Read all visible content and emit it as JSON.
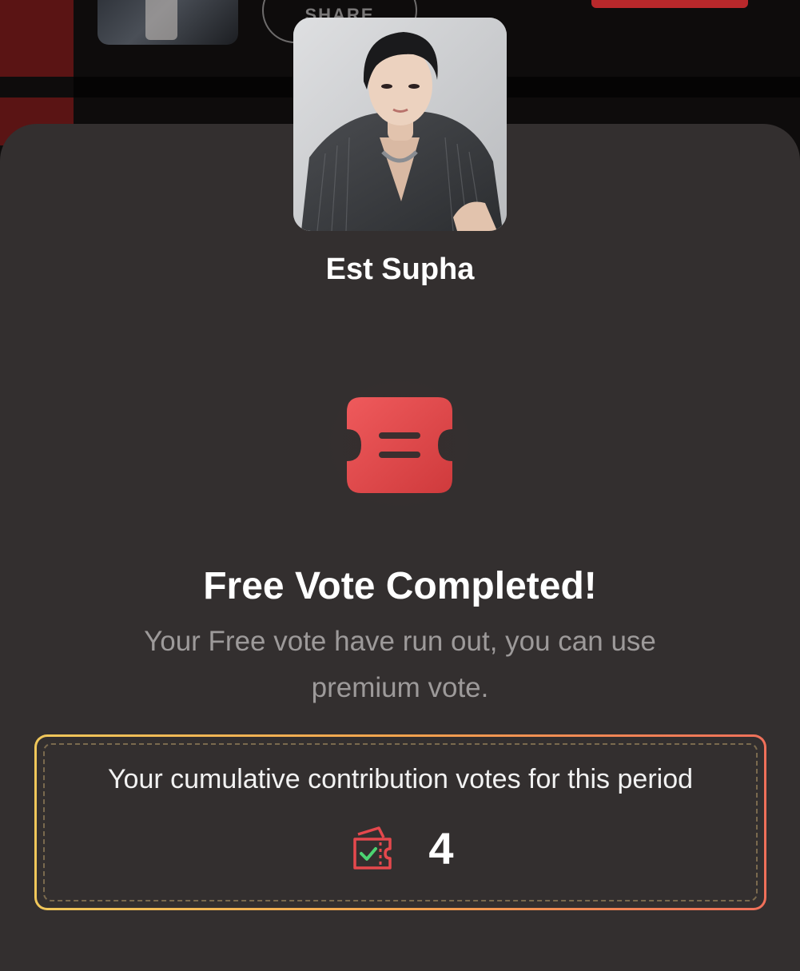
{
  "background": {
    "share_label": "SHARE"
  },
  "artist": {
    "name": "Est Supha"
  },
  "result": {
    "icon": "ticket-icon",
    "title": "Free Vote Completed!",
    "message": "Your Free vote have run out, you can use premium vote."
  },
  "contribution": {
    "label": "Your cumulative contribution votes for this period",
    "icon": "vote-ticket-check-icon",
    "count": "4"
  },
  "colors": {
    "sheet_bg": "#332f2f",
    "accent_red": "#e5484d",
    "gradient_start": "#f0c75a",
    "gradient_end": "#f0705a"
  }
}
